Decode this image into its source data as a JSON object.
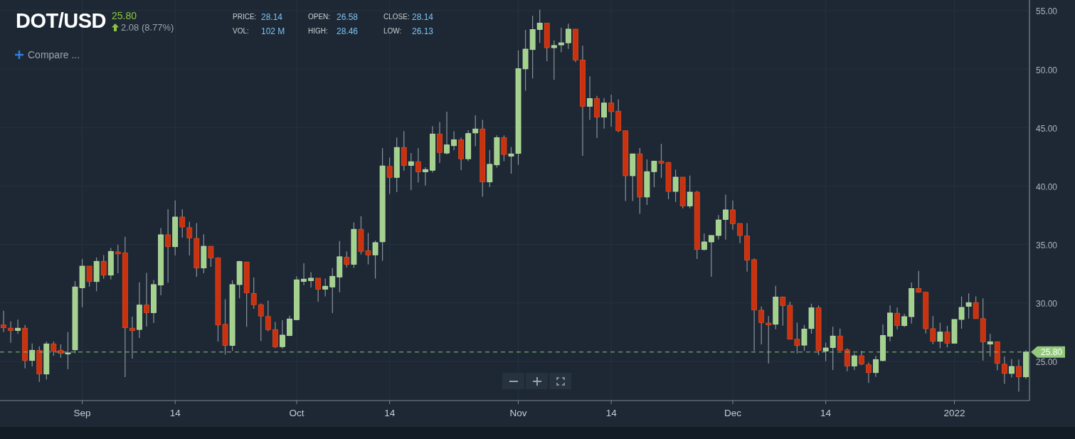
{
  "header": {
    "symbol": "DOT/USD",
    "price": "25.80",
    "change": "2.08 (8.77%)",
    "compare": "Compare ..."
  },
  "stats": [
    {
      "label": "PRICE:",
      "value": "28.14"
    },
    {
      "label": "OPEN:",
      "value": "26.58"
    },
    {
      "label": "CLOSE:",
      "value": "28.14"
    },
    {
      "label": "VOL:",
      "value": "102 M"
    },
    {
      "label": "HIGH:",
      "value": "28.46"
    },
    {
      "label": "LOW:",
      "value": "26.13"
    }
  ],
  "chart": {
    "chart_data": {
      "type": "candlestick",
      "ylim": [
        21.65,
        55.91
      ],
      "categories": [
        null,
        null,
        null,
        null,
        null,
        null,
        null,
        null,
        null,
        null,
        null,
        "Sep",
        null,
        null,
        null,
        null,
        null,
        null,
        null,
        null,
        null,
        null,
        null,
        null,
        "14",
        null,
        null,
        null,
        null,
        null,
        null,
        null,
        null,
        null,
        null,
        null,
        null,
        null,
        null,
        null,
        null,
        "Oct",
        null,
        null,
        null,
        null,
        null,
        null,
        null,
        null,
        null,
        null,
        null,
        null,
        "14",
        null,
        null,
        null,
        null,
        null,
        null,
        null,
        null,
        null,
        null,
        null,
        null,
        null,
        null,
        null,
        null,
        null,
        "Nov",
        null,
        null,
        null,
        null,
        null,
        null,
        null,
        null,
        null,
        null,
        null,
        null,
        "14",
        null,
        null,
        null,
        null,
        null,
        null,
        null,
        null,
        null,
        null,
        null,
        null,
        null,
        null,
        null,
        null,
        "Dec",
        null,
        null,
        null,
        null,
        null,
        null,
        null,
        null,
        null,
        null,
        null,
        null,
        "14",
        null,
        null,
        null,
        null,
        null,
        null,
        null,
        null,
        null,
        null,
        null,
        null,
        null,
        null,
        null,
        null,
        null,
        "2022",
        null,
        null,
        null,
        null,
        null,
        null,
        null,
        null,
        null,
        null
      ],
      "yticks": [
        {
          "value": 25,
          "label": "25.00"
        },
        {
          "value": 30,
          "label": "30.00"
        },
        {
          "value": 35,
          "label": "35.00"
        },
        {
          "value": 40,
          "label": "40.00"
        },
        {
          "value": 45,
          "label": "45.00"
        },
        {
          "value": 50,
          "label": "50.00"
        },
        {
          "value": 55,
          "label": "55.00"
        }
      ],
      "ohlc": [
        [
          28.12,
          29.34,
          27.51,
          27.88
        ],
        [
          27.84,
          28.42,
          26.6,
          27.65
        ],
        [
          27.65,
          28.57,
          27.35,
          27.84
        ],
        [
          27.84,
          28.12,
          24.41,
          25.08
        ],
        [
          25.08,
          26.54,
          24.57,
          25.95
        ],
        [
          25.95,
          26.29,
          23.25,
          23.92
        ],
        [
          23.92,
          26.7,
          23.45,
          26.5
        ],
        [
          26.5,
          26.7,
          25.48,
          25.89
        ],
        [
          25.95,
          26.46,
          25.32,
          25.69
        ],
        [
          25.69,
          27.51,
          24.33,
          25.73
        ],
        [
          25.99,
          31.87,
          25.69,
          31.37
        ],
        [
          31.3,
          33.76,
          29.64,
          33.15
        ],
        [
          33.15,
          33.15,
          31.4,
          31.83
        ],
        [
          31.83,
          33.9,
          31,
          33.56
        ],
        [
          33.56,
          34.1,
          32.07,
          32.38
        ],
        [
          32.38,
          34.71,
          32.01,
          34.41
        ],
        [
          34.37,
          34.98,
          32.54,
          34.2
        ],
        [
          34.29,
          35.66,
          23.66,
          27.88
        ],
        [
          27.84,
          28.83,
          25.24,
          27.63
        ],
        [
          27.73,
          31.77,
          27,
          29.82
        ],
        [
          29.82,
          32.58,
          27.98,
          29.17
        ],
        [
          29.17,
          31.97,
          28.28,
          31.57
        ],
        [
          31.53,
          36.4,
          30.66,
          35.83
        ],
        [
          35.83,
          38.02,
          31.73,
          34.81
        ],
        [
          34.81,
          38.77,
          34.06,
          37.35
        ],
        [
          37.35,
          38.02,
          35.58,
          36.5
        ],
        [
          36.44,
          36.94,
          34.06,
          35.56
        ],
        [
          35.52,
          36.84,
          32.24,
          32.99
        ],
        [
          32.99,
          35.87,
          32.54,
          34.85
        ],
        [
          34.85,
          34.85,
          33.09,
          33.84
        ],
        [
          33.84,
          33.9,
          26.7,
          28.12
        ],
        [
          28.17,
          30.32,
          25.59,
          26.36
        ],
        [
          26.36,
          31.94,
          25.9,
          31.57
        ],
        [
          31.57,
          33.6,
          30.4,
          33.54
        ],
        [
          33.5,
          33.5,
          27.96,
          30.86
        ],
        [
          30.82,
          32.18,
          29.5,
          29.85
        ],
        [
          29.85,
          29.95,
          26.75,
          28.88
        ],
        [
          28.84,
          30.2,
          27.58,
          27.72
        ],
        [
          27.72,
          28.37,
          26.14,
          26.26
        ],
        [
          26.26,
          28.53,
          26.1,
          27.25
        ],
        [
          27.21,
          28.9,
          27.15,
          28.63
        ],
        [
          28.57,
          32.28,
          28.53,
          31.98
        ],
        [
          31.84,
          33.4,
          31.53,
          32.04
        ],
        [
          31.9,
          32.63,
          31.33,
          32.12
        ],
        [
          32.12,
          32.12,
          30.11,
          31.17
        ],
        [
          31.17,
          32.08,
          30.56,
          31.43
        ],
        [
          31.37,
          32.99,
          29.14,
          32.28
        ],
        [
          32.22,
          35.29,
          30.92,
          33.95
        ],
        [
          33.9,
          34.41,
          33.05,
          33.3
        ],
        [
          33.3,
          36.89,
          32.99,
          36.3
        ],
        [
          36.3,
          37.42,
          34.15,
          34.41
        ],
        [
          34.47,
          35.99,
          33.3,
          34.11
        ],
        [
          34.11,
          35.33,
          32.08,
          35.16
        ],
        [
          35.23,
          43.24,
          33.6,
          41.72
        ],
        [
          41.68,
          42.43,
          39.32,
          40.74
        ],
        [
          40.74,
          44.15,
          39.48,
          43.3
        ],
        [
          43.3,
          44.7,
          41.31,
          41.76
        ],
        [
          41.76,
          42.83,
          39.65,
          42.08
        ],
        [
          42.08,
          43.24,
          40.3,
          41.21
        ],
        [
          41.21,
          41.61,
          40.05,
          41.41
        ],
        [
          41.35,
          45.12,
          41.15,
          44.45
        ],
        [
          44.45,
          45.47,
          41.98,
          42.87
        ],
        [
          42.82,
          46.36,
          42.7,
          43.52
        ],
        [
          43.45,
          44.68,
          43.05,
          43.96
        ],
        [
          43.96,
          44.14,
          41.35,
          42.33
        ],
        [
          42.33,
          44.77,
          42.12,
          44.49
        ],
        [
          44.54,
          46.05,
          43.4,
          44.88
        ],
        [
          44.88,
          45.66,
          39.09,
          40.35
        ],
        [
          40.35,
          43.09,
          39.9,
          41.86
        ],
        [
          41.81,
          44.33,
          41.58,
          44.14
        ],
        [
          44.14,
          44.33,
          42.12,
          42.7
        ],
        [
          42.56,
          43.33,
          41.05,
          42.75
        ],
        [
          42.79,
          51.6,
          41.81,
          50.04
        ],
        [
          50.02,
          53.35,
          48.15,
          51.71
        ],
        [
          51.67,
          54.56,
          49.2,
          53.39
        ],
        [
          53.39,
          55.09,
          52.25,
          53.93
        ],
        [
          53.93,
          53.93,
          50.67,
          51.83
        ],
        [
          51.83,
          52.46,
          49.08,
          52.02
        ],
        [
          52.07,
          53.53,
          51.44,
          52.25
        ],
        [
          52.25,
          53.88,
          51.72,
          53.42
        ],
        [
          53.42,
          53.42,
          50.6,
          50.78
        ],
        [
          50.78,
          52,
          42.58,
          46.82
        ],
        [
          46.82,
          49.39,
          45.66,
          47.48
        ],
        [
          47.48,
          47.71,
          44.1,
          45.89
        ],
        [
          45.89,
          47.52,
          44.91,
          47.1
        ],
        [
          47.1,
          47.8,
          45.08,
          46.36
        ],
        [
          46.4,
          47.41,
          44.61,
          44.73
        ],
        [
          44.73,
          44.73,
          38.72,
          40.88
        ],
        [
          40.88,
          42.75,
          38.72,
          42.75
        ],
        [
          42.75,
          43.26,
          37.62,
          39.06
        ],
        [
          39.06,
          42.28,
          38.39,
          41.23
        ],
        [
          41.23,
          42.16,
          39.9,
          42.12
        ],
        [
          42.12,
          43.6,
          40.7,
          41.95
        ],
        [
          42.01,
          42.07,
          38.87,
          39.54
        ],
        [
          39.54,
          41.4,
          38.63,
          40.76
        ],
        [
          40.76,
          40.76,
          38.1,
          38.3
        ],
        [
          38.3,
          40.9,
          38.1,
          39.48
        ],
        [
          39.48,
          39.58,
          33.76,
          34.57
        ],
        [
          34.57,
          35.93,
          34.47,
          35.22
        ],
        [
          35.22,
          35.77,
          32.24,
          35.77
        ],
        [
          35.77,
          37.51,
          35.42,
          37.1
        ],
        [
          37.14,
          39.27,
          35.42,
          37.96
        ],
        [
          37.96,
          38.77,
          36.27,
          36.78
        ],
        [
          36.8,
          36.8,
          35.12,
          35.77
        ],
        [
          35.73,
          36.84,
          32.68,
          33.66
        ],
        [
          33.7,
          33.8,
          25.89,
          29.4
        ],
        [
          29.38,
          29.7,
          26.46,
          28.32
        ],
        [
          28.28,
          28.87,
          24.83,
          28.12
        ],
        [
          28.18,
          31.46,
          27.75,
          30.51
        ],
        [
          30.51,
          30.55,
          28.06,
          29.78
        ],
        [
          29.8,
          30.11,
          26.9,
          26.9
        ],
        [
          26.9,
          28.32,
          25.68,
          26.35
        ],
        [
          26.39,
          28.12,
          25.89,
          27.77
        ],
        [
          27.81,
          29.94,
          27.37,
          29.58
        ],
        [
          29.58,
          29.78,
          25.54,
          25.93
        ],
        [
          25.89,
          26.6,
          25.02,
          26.15
        ],
        [
          26.19,
          27.96,
          24.27,
          27.17
        ],
        [
          27.17,
          27.81,
          25.89,
          25.95
        ],
        [
          25.99,
          26.13,
          24.16,
          24.61
        ],
        [
          24.61,
          25.68,
          24.27,
          25.48
        ],
        [
          25.48,
          25.89,
          24.67,
          24.77
        ],
        [
          24.71,
          24.91,
          23.15,
          24.04
        ],
        [
          24.04,
          25.48,
          23.68,
          25.16
        ],
        [
          25.07,
          28.16,
          25,
          27.22
        ],
        [
          27.15,
          29.79,
          26.72,
          29.14
        ],
        [
          29.12,
          29.6,
          27.75,
          28.06
        ],
        [
          28.06,
          29.07,
          27.94,
          28.83
        ],
        [
          28.83,
          31.75,
          28.24,
          31.23
        ],
        [
          31.23,
          32.74,
          30.87,
          30.92
        ],
        [
          30.92,
          30.92,
          27.39,
          27.8
        ],
        [
          27.8,
          28.88,
          26.48,
          26.72
        ],
        [
          26.72,
          28.31,
          26.12,
          27.51
        ],
        [
          27.51,
          28.04,
          26.2,
          26.56
        ],
        [
          26.56,
          28.59,
          26.56,
          28.59
        ],
        [
          28.59,
          30.56,
          27.8,
          29.62
        ],
        [
          29.72,
          30.82,
          28.66,
          30.03
        ],
        [
          30.03,
          30.56,
          28.66,
          28.66
        ],
        [
          28.66,
          30.39,
          25.07,
          26.68
        ],
        [
          26.48,
          27.35,
          25.43,
          26.68
        ],
        [
          26.68,
          26.72,
          24.23,
          24.83
        ],
        [
          24.76,
          25.43,
          23.08,
          23.97
        ],
        [
          23.97,
          25.19,
          23.61,
          24.57
        ],
        [
          24.57,
          25.16,
          22.41,
          23.68
        ],
        [
          23.68,
          25.96,
          23.51,
          25.8
        ]
      ],
      "grid": true,
      "ref_lines": [
        {
          "axis": "y",
          "value": 25.8,
          "label": "25.80"
        }
      ]
    }
  }
}
